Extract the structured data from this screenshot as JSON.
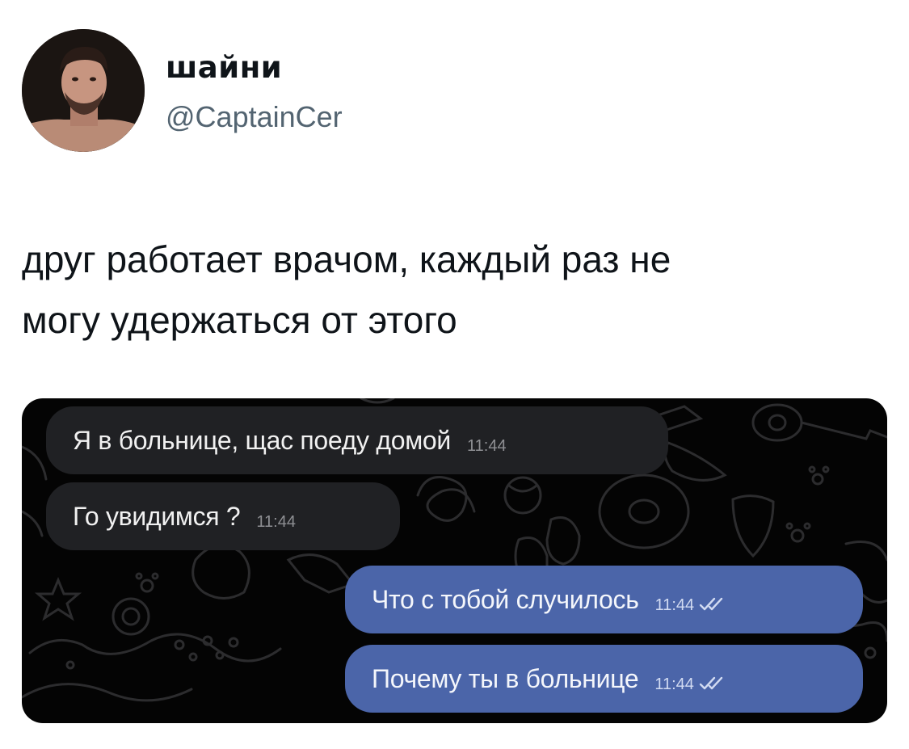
{
  "author": {
    "name": "шайни",
    "handle": "@CaptainCer"
  },
  "tweet": {
    "text_line1": "друг работает врачом, каждый раз не",
    "text_line2": "могу удержаться от этого"
  },
  "chat": {
    "messages": [
      {
        "direction": "incoming",
        "text": "Я в больнице, щас поеду домой",
        "time": "11:44"
      },
      {
        "direction": "incoming",
        "text": "Го увидимся ?",
        "time": "11:44"
      },
      {
        "direction": "outgoing",
        "text": "Что с тобой случилось",
        "time": "11:44",
        "status": "read-double-check-icon"
      },
      {
        "direction": "outgoing",
        "text": "Почему ты в больнице",
        "time": "11:44",
        "status": "read-double-check-icon"
      }
    ],
    "colors": {
      "background": "#040404",
      "incoming_bubble": "#202124",
      "outgoing_bubble": "#4b65a9"
    }
  }
}
